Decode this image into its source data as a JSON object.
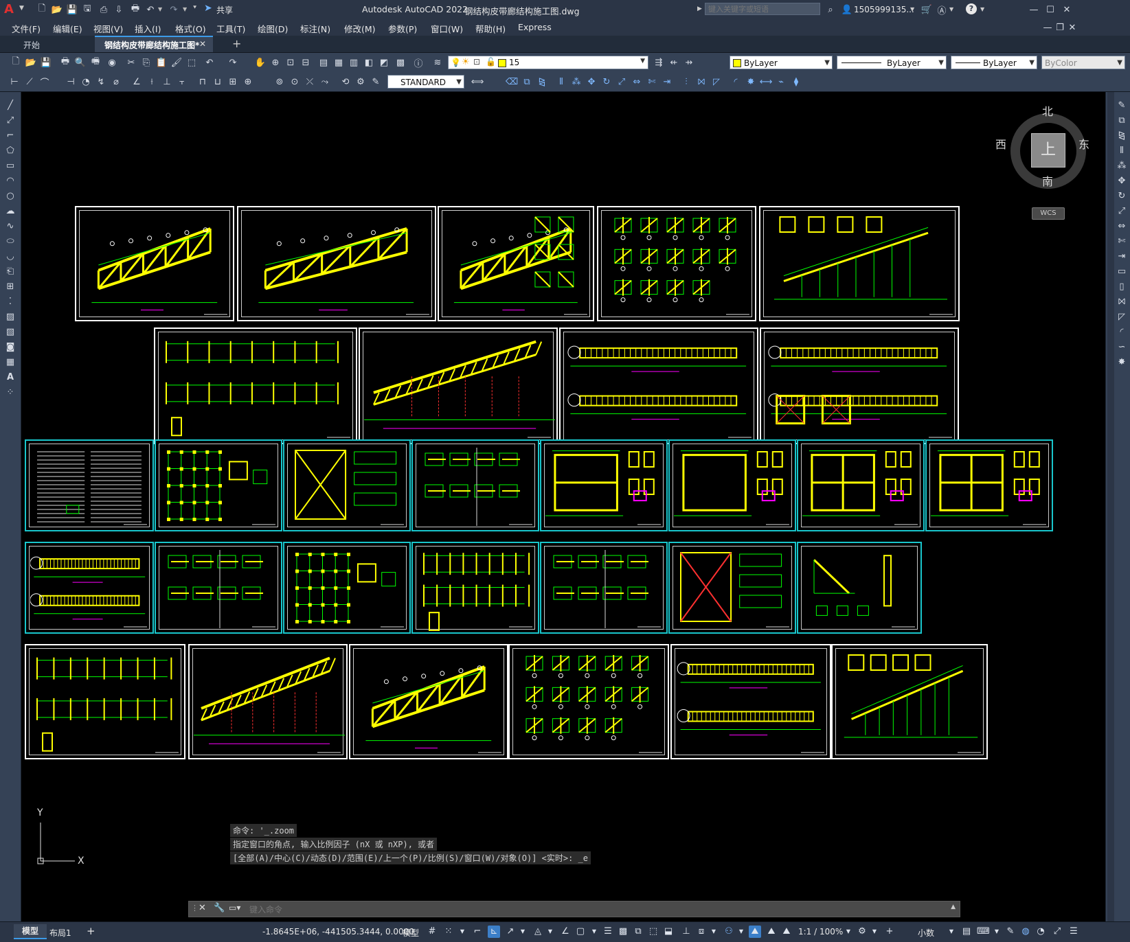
{
  "titlebar": {
    "app_letter": "A",
    "share_label": "共享",
    "app_title": "Autodesk AutoCAD 2022",
    "file_name": "钢结构皮带廊结构施工图.dwg",
    "search_placeholder": "键入关键字或短语",
    "user_name": "1505999135...",
    "help_label": "?"
  },
  "menu": [
    "文件(F)",
    "编辑(E)",
    "视图(V)",
    "插入(I)",
    "格式(O)",
    "工具(T)",
    "绘图(D)",
    "标注(N)",
    "修改(M)",
    "参数(P)",
    "窗口(W)",
    "帮助(H)",
    "Express"
  ],
  "tabs": {
    "start": "开始",
    "active": "钢结构皮带廊结构施工图*",
    "close": "✕",
    "add": "+"
  },
  "toolbar": {
    "layer_value": "15",
    "color_value": "ByLayer",
    "linetype_value": "ByLayer",
    "lineweight_value": "ByLayer",
    "plotstyle_value": "ByColor",
    "textstyle_value": "STANDARD"
  },
  "viewcube": {
    "north": "北",
    "south": "南",
    "east": "东",
    "west": "西",
    "top": "上",
    "wcs": "WCS"
  },
  "ucs": {
    "y_label": "Y",
    "x_label": "X"
  },
  "command": {
    "history1": "命令: '_.zoom",
    "history2": "指定窗口的角点, 输入比例因子 (nX 或 nXP), 或者",
    "history3": "[全部(A)/中心(C)/动态(D)/范围(E)/上一个(P)/比例(S)/窗口(W)/对象(O)] <实时>: _e",
    "placeholder": "键入命令"
  },
  "status": {
    "model_tab": "模型",
    "layout_tab": "布局1",
    "add_layout": "+",
    "coordinates": "-1.8645E+06, -441505.3444, 0.0000",
    "space": "模型",
    "scale": "1:1 / 100%",
    "units": "小数"
  },
  "colors": {
    "sheet_border": "#ffffff",
    "sheet_border_cyan": "#19c6cc",
    "line_yellow": "#ffff00",
    "line_green": "#00ff00",
    "line_magenta": "#ff00ff",
    "line_red": "#ff3030",
    "line_cyan": "#00ffff"
  }
}
